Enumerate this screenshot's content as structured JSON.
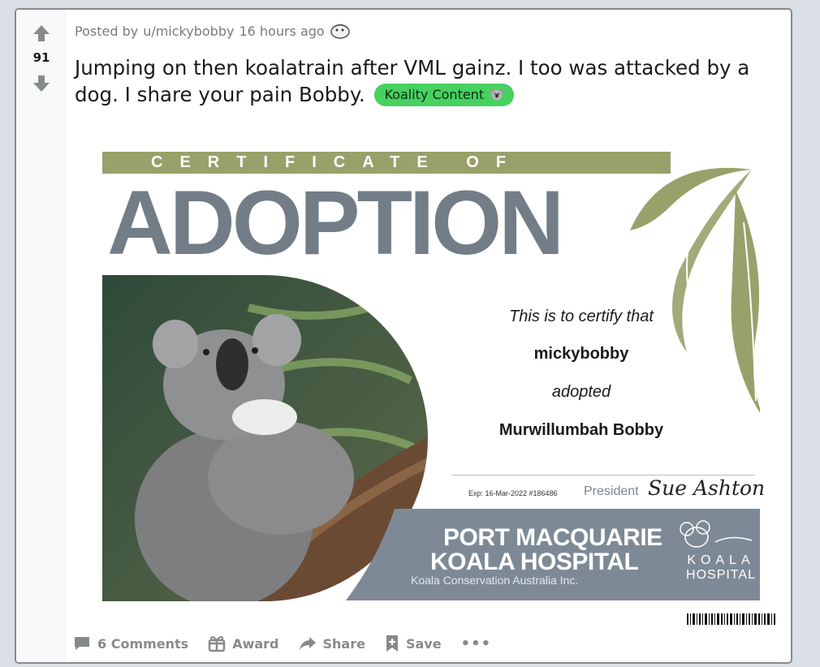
{
  "post": {
    "score": "91",
    "meta_prefix": "Posted by",
    "author": "u/mickybobby",
    "time": "16 hours ago",
    "title": "Jumping on then koalatrain after VML gainz. I too was attacked by a dog. I share your pain Bobby.",
    "flair": "Koality Content"
  },
  "certificate": {
    "header": "CERTIFICATE OF",
    "headline": "ADOPTION",
    "line1": "This is to certify that",
    "name": "mickybobby",
    "line3": "adopted",
    "koala": "Murwillumbah Bobby",
    "expiry": "Exp: 16-Mar-2022 #186486",
    "president_label": "President",
    "signature": "Sue Ashton",
    "org_line1": "PORT MACQUARIE",
    "org_line2": "KOALA HOSPITAL",
    "org_sub": "Koala Conservation Australia Inc.",
    "logo_line1": "KOALA",
    "logo_line2": "HOSPITAL"
  },
  "actions": {
    "comments": "6 Comments",
    "award": "Award",
    "share": "Share",
    "save": "Save",
    "more": "•••"
  },
  "colors": {
    "flair_bg": "#46d160",
    "olive": "#9aa06a",
    "slate": "#737d87",
    "banner": "#7d8a96"
  },
  "icons": [
    "upvote-icon",
    "downvote-icon",
    "avatar-icon",
    "koala-emoji-icon",
    "comment-icon",
    "award-icon",
    "share-icon",
    "save-icon"
  ]
}
